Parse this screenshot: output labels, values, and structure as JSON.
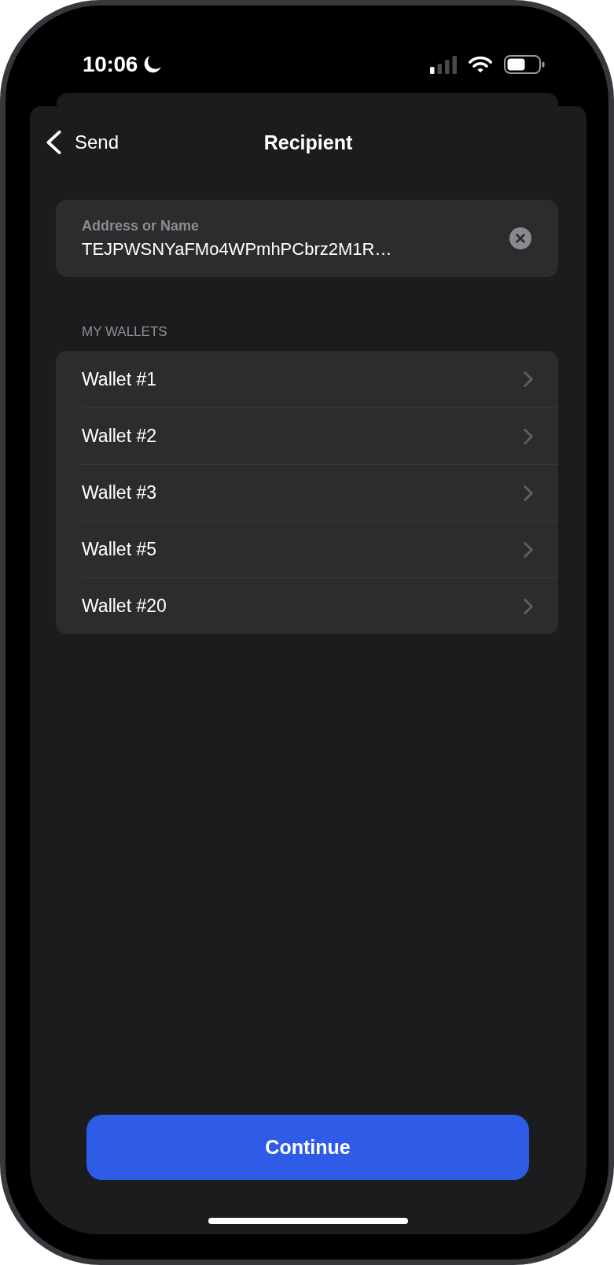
{
  "status_bar": {
    "time": "10:06"
  },
  "nav": {
    "back_label": "Send",
    "title": "Recipient"
  },
  "address_field": {
    "label": "Address or Name",
    "value": "TEJPWSNYaFMo4WPmhPCbrz2M1R…"
  },
  "wallets": {
    "header": "MY WALLETS",
    "items": [
      {
        "name": "Wallet #1"
      },
      {
        "name": "Wallet #2"
      },
      {
        "name": "Wallet #3"
      },
      {
        "name": "Wallet #5"
      },
      {
        "name": "Wallet #20"
      }
    ]
  },
  "continue_button": {
    "label": "Continue"
  }
}
